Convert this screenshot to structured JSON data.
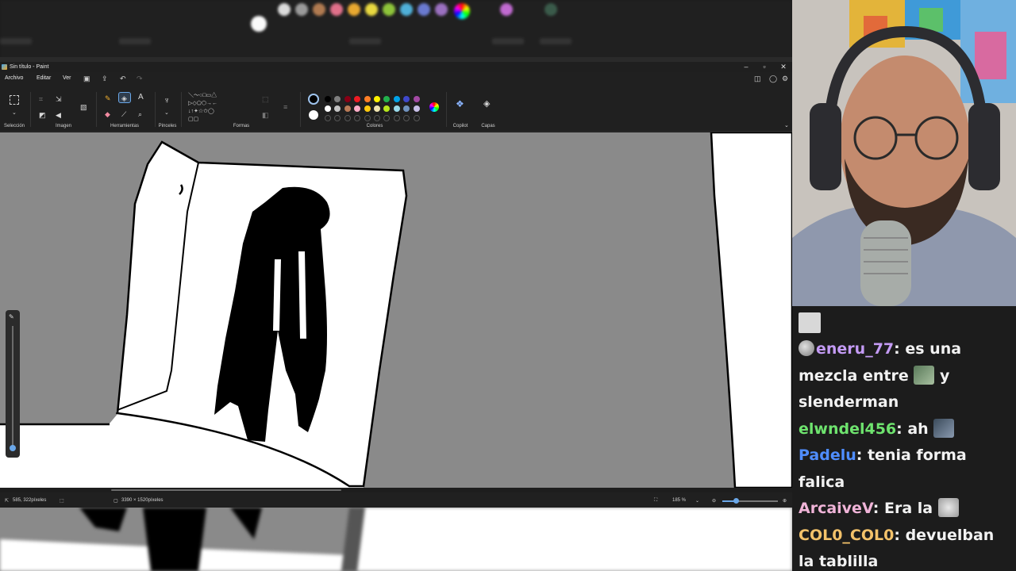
{
  "paint": {
    "title": "Sin título - Paint",
    "menu": {
      "file": "Archivo",
      "edit": "Editar",
      "view": "Ver"
    },
    "groups": {
      "selection": "Selección",
      "image": "Imagen",
      "tools": "Herramientas",
      "brushes": "Pinceles",
      "shapes": "Formas",
      "colors": "Colores",
      "copilot": "Copilot",
      "layers": "Capas"
    },
    "status": {
      "cursor_pos": "585, 322píxeles",
      "canvas_size": "3390 × 1520píxeles",
      "zoom": "185 %"
    },
    "palette_row1": [
      "#000000",
      "#7f7f7f",
      "#880015",
      "#ed1c24",
      "#ff7f27",
      "#fff200",
      "#22b14c",
      "#00a2e8",
      "#3f48cc",
      "#a349a4"
    ],
    "palette_row2": [
      "#ffffff",
      "#c3c3c3",
      "#b97a57",
      "#ffaec9",
      "#ffc90e",
      "#efe4b0",
      "#b5e61d",
      "#99d9ea",
      "#7092be",
      "#c8bfe7"
    ],
    "canvas_colors": {
      "background": "#8a8a8a",
      "paper": "#ffffff",
      "ink": "#000000"
    }
  },
  "chat": {
    "messages": [
      {
        "user": "eneru_77",
        "color": "#c49bf5",
        "text_a": ": es una mezcla entre ",
        "text_b": " y slenderman"
      },
      {
        "user": "elwndel456",
        "color": "#6ee36e",
        "text_a": ": ah "
      },
      {
        "user": "Padelu",
        "color": "#4f8dff",
        "text_a": ": tenia forma falica"
      },
      {
        "user": "ArcaiveV",
        "color": "#f0b4d8",
        "text_a": ": Era la "
      },
      {
        "user": "COL0_COL0",
        "color": "#f3c26a",
        "text_a": ": devuelban la tablilla"
      }
    ]
  }
}
